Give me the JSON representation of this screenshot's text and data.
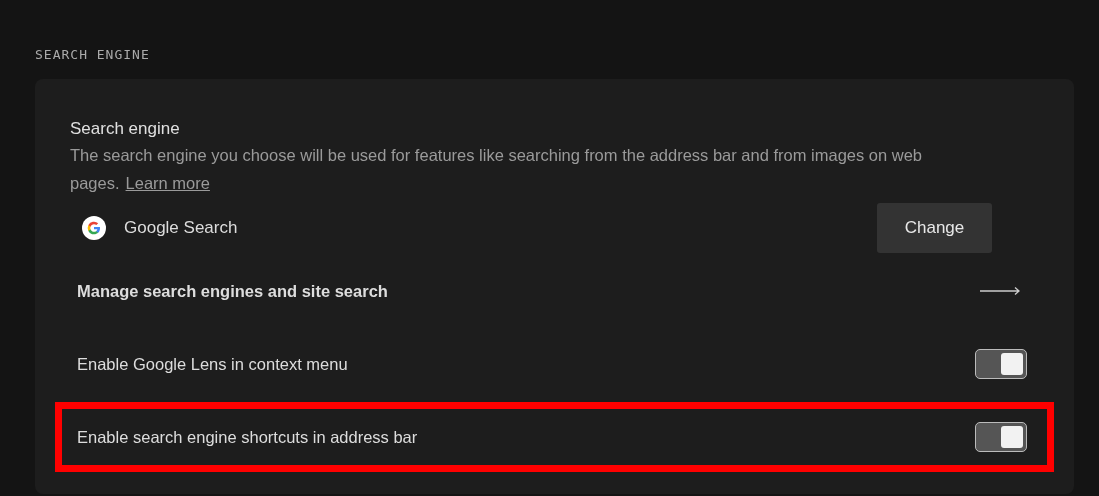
{
  "section_title": "SEARCH ENGINE",
  "search_engine": {
    "title": "Search engine",
    "description": "The search engine you choose will be used for features like searching from the address bar and from images on web pages.",
    "learn_more": "Learn more",
    "current": "Google Search",
    "change_button": "Change"
  },
  "rows": [
    {
      "kind": "link",
      "label": "Manage search engines and site search",
      "highlighted": false
    },
    {
      "kind": "toggle",
      "label": "Enable Google Lens in context menu",
      "on": true,
      "highlighted": false
    },
    {
      "kind": "toggle",
      "label": "Enable search engine shortcuts in address bar",
      "on": true,
      "highlighted": true
    }
  ]
}
